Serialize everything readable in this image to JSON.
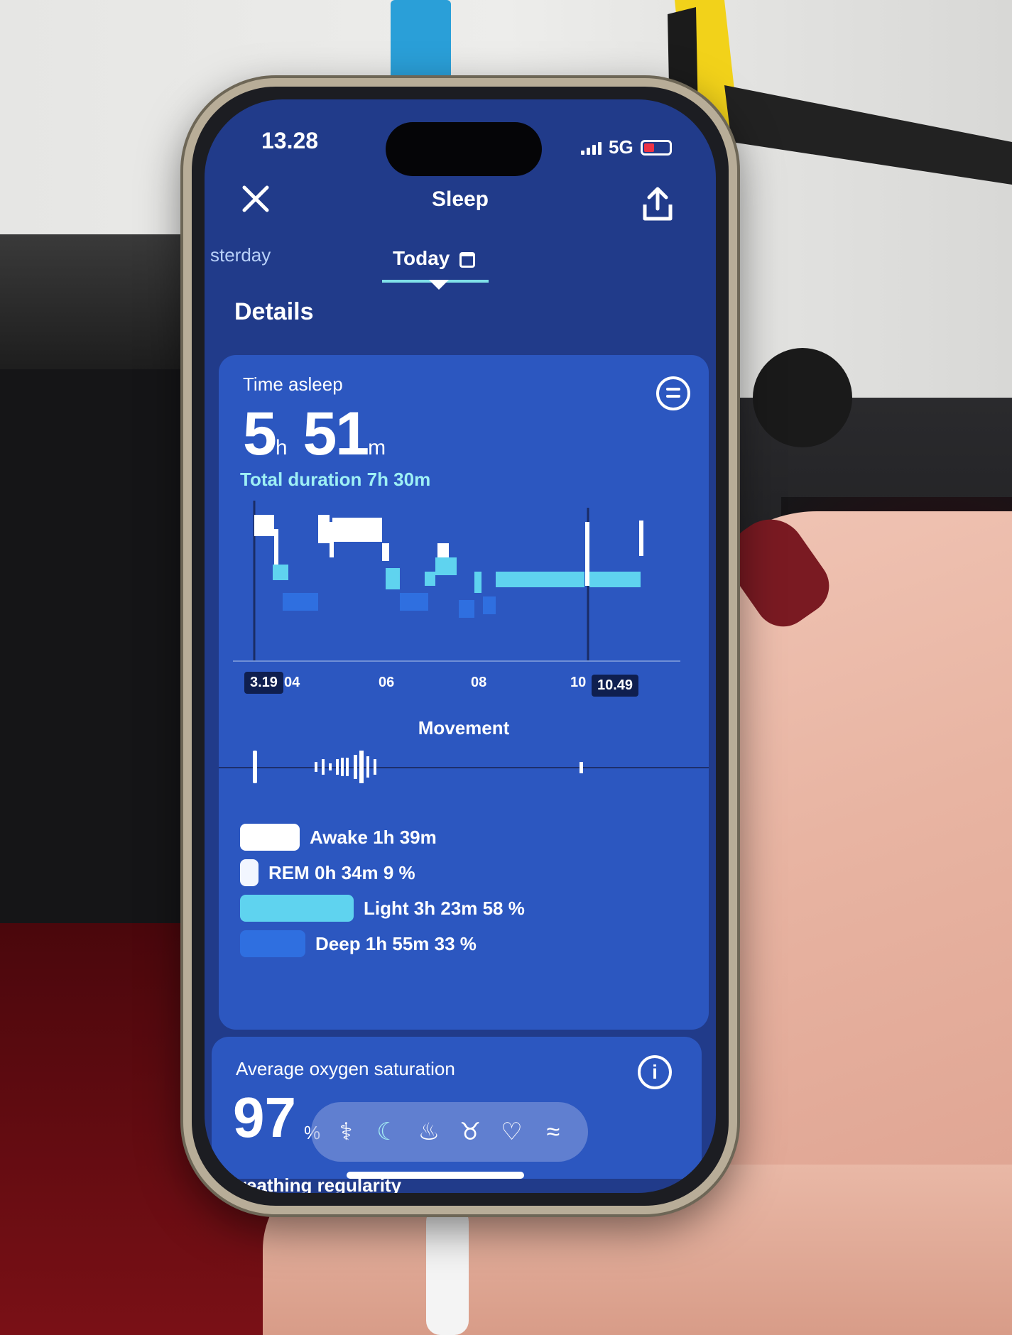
{
  "status_bar": {
    "time": "13.28",
    "network": "5G"
  },
  "header": {
    "title": "Sleep",
    "close_icon": "close-icon",
    "share_icon": "share-icon"
  },
  "tabs": {
    "previous": "sterday",
    "current": "Today"
  },
  "section_title": "Details",
  "time_asleep": {
    "label": "Time asleep",
    "hours": "5",
    "hours_unit": "h",
    "minutes": "51",
    "minutes_unit": "m",
    "total_duration": "Total duration 7h 30m"
  },
  "hypnogram": {
    "start_label": "3.19",
    "end_label": "10.49",
    "ticks": [
      "04",
      "06",
      "08",
      "10"
    ],
    "colors": {
      "awake": "#ffffff",
      "rem": "#ffffff",
      "light": "#5fd3ef",
      "deep": "#2f6fe0"
    }
  },
  "movement": {
    "title": "Movement"
  },
  "legend": [
    {
      "key": "awake",
      "text": "Awake 1h 39m",
      "color": "#ffffff"
    },
    {
      "key": "rem",
      "text": "REM 0h 34m 9 %",
      "color": "#f2f6ff"
    },
    {
      "key": "light",
      "text": "Light 3h 23m 58 %",
      "color": "#5fd3ef"
    },
    {
      "key": "deep",
      "text": "Deep 1h 55m 33 %",
      "color": "#2f6fe0"
    }
  ],
  "oxygen": {
    "label": "Average oxygen saturation",
    "value": "97",
    "unit": "%"
  },
  "tab_bar": [
    "sprout-icon",
    "moon-icon",
    "flame-icon",
    "fork-icon",
    "heart-icon",
    "waves-icon"
  ],
  "next_card": {
    "title": "Breathing regularity"
  }
}
